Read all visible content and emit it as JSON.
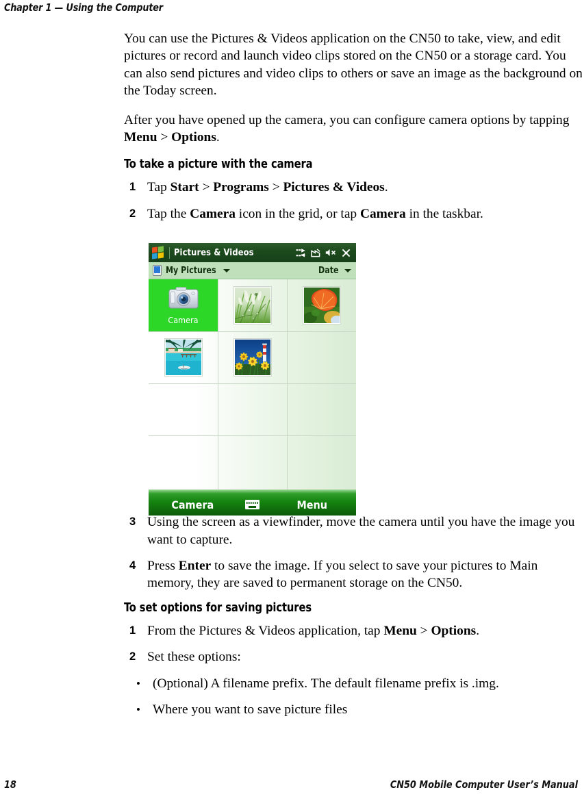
{
  "page": {
    "running_head": "Chapter 1 — Using the Computer",
    "page_number": "18",
    "footer_title": "CN50 Mobile Computer User’s Manual"
  },
  "content": {
    "para1": "You can use the Pictures & Videos application on the CN50 to take, view, and edit pictures or record and launch video clips stored on the CN50 or a storage card. You can also send pictures and video clips to others or save an image as the background on the Today screen.",
    "para2_a": "After you have opened up the camera, you can configure camera options by tapping ",
    "para2_menu": "Menu",
    "para2_gt": " > ",
    "para2_options": "Options",
    "para2_end": ".",
    "heading1": "To take a picture with the camera",
    "step1_num": "1",
    "step1_a": "Tap ",
    "step1_start": "Start",
    "step1_gt1": " > ",
    "step1_programs": "Programs",
    "step1_gt2": " > ",
    "step1_pv": "Pictures & Videos",
    "step1_end": ".",
    "step2_num": "2",
    "step2_a": "Tap the ",
    "step2_camera1": "Camera",
    "step2_b": " icon in the grid, or tap ",
    "step2_camera2": "Camera",
    "step2_c": " in the taskbar.",
    "step3_num": "3",
    "step3_text": "Using the screen as a viewfinder, move the camera until you have the image you want to capture.",
    "step4_num": "4",
    "step4_a": "Press ",
    "step4_enter": "Enter",
    "step4_b": " to save the image. If you select to save your pictures to Main memory, they are saved to permanent storage on the CN50.",
    "heading2": "To set options for saving pictures",
    "step5_num": "1",
    "step5_a": "From the Pictures & Videos application, tap ",
    "step5_menu": "Menu",
    "step5_gt": " > ",
    "step5_options": "Options",
    "step5_end": ".",
    "step6_num": "2",
    "step6_text": "Set these options:",
    "bullet_dot": "•",
    "bullet1": "(Optional) A filename prefix. The default filename prefix is .img.",
    "bullet2": "Where you want to save picture files"
  },
  "device": {
    "titlebar": {
      "start_icon": "windows-start-flag",
      "title": "Pictures & Videos",
      "icons": [
        "connectivity-icon",
        "no-signal-icon",
        "volume-muted-icon",
        "close-icon"
      ]
    },
    "folderbar": {
      "device_icon": "device-storage-icon",
      "folder_label": "My Pictures",
      "folder_caret": "chevron-down-icon",
      "sort_label": "Date",
      "sort_caret": "chevron-down-icon"
    },
    "grid": {
      "cells": [
        {
          "type": "camera",
          "label": "Camera",
          "selected": true
        },
        {
          "type": "photo",
          "label": "grass-photo",
          "selected": false
        },
        {
          "type": "photo",
          "label": "maple-leaf-photo",
          "selected": false
        },
        {
          "type": "photo",
          "label": "tropical-beach-photo",
          "selected": false
        },
        {
          "type": "photo",
          "label": "yellow-flowers-photo",
          "selected": false
        },
        {
          "type": "empty",
          "label": "",
          "selected": false
        }
      ]
    },
    "softbar": {
      "left_label": "Camera",
      "keyboard_icon": "keyboard-icon",
      "right_label": "Menu"
    },
    "colors": {
      "titlebar_green": "#1d4a1d",
      "folderbar_green": "#bfe0ba",
      "selection_green": "#2cd728",
      "softbar_green": "#14820f"
    }
  }
}
